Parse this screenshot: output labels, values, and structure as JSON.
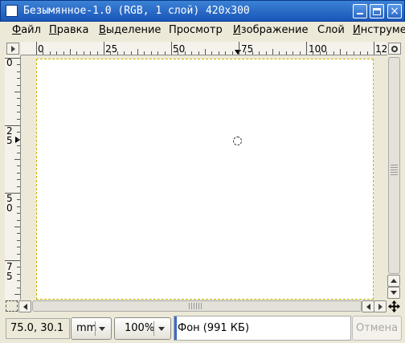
{
  "window": {
    "title": "Безымянное-1.0 (RGB, 1 слой) 420x300",
    "buttons": [
      "minimize-icon",
      "maximize-icon",
      "close-icon"
    ],
    "close_glyph": "×"
  },
  "menu": {
    "items": [
      {
        "label": "Файл",
        "u": "Ф",
        "rest": "айл"
      },
      {
        "label": "Правка",
        "u": "П",
        "rest": "равка"
      },
      {
        "label": "Выделение",
        "u": "В",
        "rest": "ыделение"
      },
      {
        "label": "Просмотр",
        "u": "",
        "rest": "Просмотр"
      },
      {
        "label": "Изображение",
        "u": "И",
        "rest": "зображение"
      },
      {
        "label": "Слой",
        "u": "",
        "rest": "Слой"
      },
      {
        "label": "Инструме",
        "u": "И",
        "rest": "нструме"
      }
    ]
  },
  "rulers": {
    "horizontal_labels": [
      "0",
      "25",
      "50",
      "75",
      "100",
      "12"
    ],
    "vertical_labels": [
      [
        "0"
      ],
      [
        "2",
        "5"
      ],
      [
        "5",
        "0"
      ],
      [
        "7",
        "5"
      ]
    ]
  },
  "status": {
    "coords": "75.0, 30.1",
    "unit": "mm",
    "zoom": "100%",
    "layer_info": "Фон (991 КБ)",
    "cancel_label": "Отмена"
  },
  "colors": {
    "titlebar": "#1a56b8",
    "canvas": "#ffffff",
    "selection_border": "#c8b400"
  }
}
